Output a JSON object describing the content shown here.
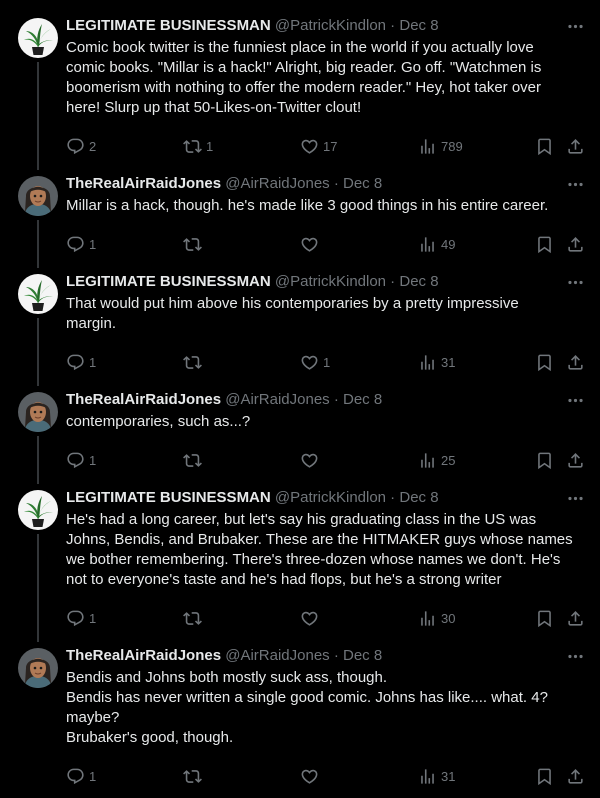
{
  "tweets": [
    {
      "name": "LEGITIMATE BUSINESSMAN",
      "handle": "@PatrickKindlon",
      "date": "Dec 8",
      "avatar": "plant",
      "lines": [
        "Comic book twitter is the funniest place in the world if you actually love",
        "comic books. \"Millar is a hack!\" Alright, big reader. Go off. \"Watchmen is",
        "boomerism with nothing to offer the modern reader.\" Hey, hot taker over",
        "here! Slurp up that 50-Likes-on-Twitter clout!"
      ],
      "replies": "2",
      "retweets": "1",
      "likes": "17",
      "views": "789"
    },
    {
      "name": "TheRealAirRaidJones",
      "handle": "@AirRaidJones",
      "date": "Dec 8",
      "avatar": "person",
      "lines": [
        "Millar is a hack, though. he's made like 3 good things in his entire career."
      ],
      "replies": "1",
      "retweets": "",
      "likes": "",
      "views": "49"
    },
    {
      "name": "LEGITIMATE BUSINESSMAN",
      "handle": "@PatrickKindlon",
      "date": "Dec 8",
      "avatar": "plant",
      "lines": [
        "That would put him above his contemporaries by a pretty impressive",
        "margin."
      ],
      "replies": "1",
      "retweets": "",
      "likes": "1",
      "views": "31"
    },
    {
      "name": "TheRealAirRaidJones",
      "handle": "@AirRaidJones",
      "date": "Dec 8",
      "avatar": "person",
      "lines": [
        "contemporaries, such as...?"
      ],
      "replies": "1",
      "retweets": "",
      "likes": "",
      "views": "25"
    },
    {
      "name": "LEGITIMATE BUSINESSMAN",
      "handle": "@PatrickKindlon",
      "date": "Dec 8",
      "avatar": "plant",
      "lines": [
        "He's had a long career, but let's say his graduating class in the US was",
        "Johns, Bendis, and Brubaker. These are the HITMAKER guys whose names",
        "we bother remembering. There's three-dozen whose names we don't. He's",
        "not to everyone's taste and he's had flops, but he's a strong writer"
      ],
      "replies": "1",
      "retweets": "",
      "likes": "",
      "views": "30"
    },
    {
      "name": "TheRealAirRaidJones",
      "handle": "@AirRaidJones",
      "date": "Dec 8",
      "avatar": "person",
      "lines": [
        "Bendis and Johns both mostly suck ass, though.",
        "Bendis has never written a single good comic. Johns has like.... what. 4?",
        "maybe?",
        "Brubaker's good, though."
      ],
      "replies": "1",
      "retweets": "",
      "likes": "",
      "views": "31"
    }
  ],
  "colors": {
    "background": "#000000",
    "text": "#e7e9ea",
    "secondary": "#71767b",
    "thread_line": "#333639"
  },
  "icons": {
    "reply": "reply-icon",
    "retweet": "retweet-icon",
    "like": "heart-icon",
    "views": "views-icon",
    "bookmark": "bookmark-icon",
    "share": "share-icon",
    "more": "more-icon"
  }
}
